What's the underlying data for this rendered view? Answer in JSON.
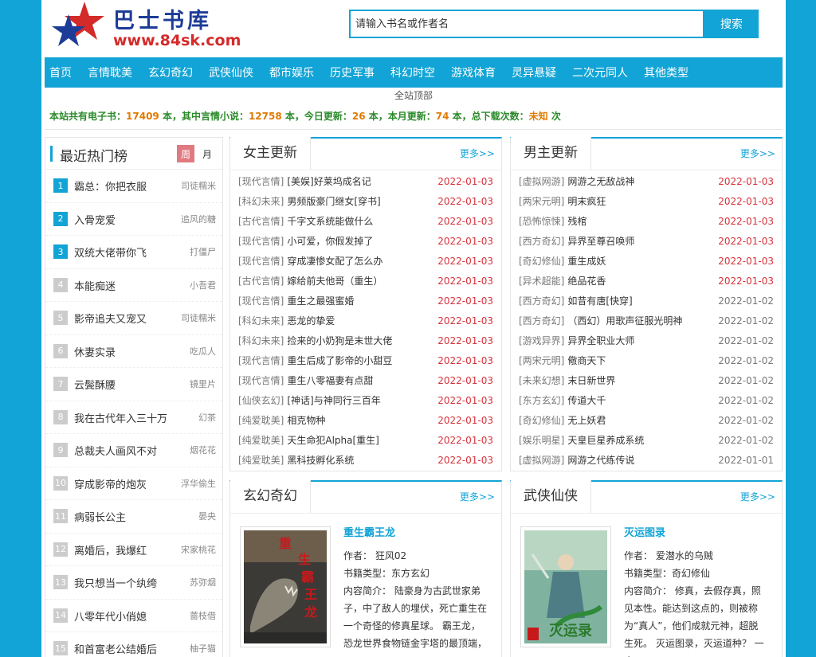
{
  "site": {
    "title": "巴士书库",
    "url": "www.84sk.com"
  },
  "search": {
    "placeholder": "请输入书名或作者名",
    "button": "搜索"
  },
  "nav": [
    "首页",
    "言情耽美",
    "玄幻奇幻",
    "武侠仙侠",
    "都市娱乐",
    "历史军事",
    "科幻时空",
    "游戏体育",
    "灵异悬疑",
    "二次元同人",
    "其他类型"
  ],
  "subnav": "全站顶部",
  "stats": {
    "p1": "本站共有电子书：",
    "total": "17409",
    "p2": " 本，其中言情小说：",
    "romance": "12758",
    "p3": " 本，今日更新：",
    "today": "26",
    "p4": " 本，本月更新：",
    "month": "74",
    "p5": " 本，总下载次数：",
    "downloads": "未知",
    "p6": " 次"
  },
  "rank": {
    "title": "最近热门榜",
    "week": "周",
    "month": "月",
    "items": [
      {
        "n": "1",
        "book": "霸总：你把衣服",
        "author": "司徒糯米"
      },
      {
        "n": "2",
        "book": "入骨宠爱",
        "author": "追风的糖"
      },
      {
        "n": "3",
        "book": "双统大佬带你飞",
        "author": "打僵尸"
      },
      {
        "n": "4",
        "book": "本能痴迷",
        "author": "小吾君"
      },
      {
        "n": "5",
        "book": "影帝追夫又宠又",
        "author": "司徒糯米"
      },
      {
        "n": "6",
        "book": "休妻实录",
        "author": "吃瓜人"
      },
      {
        "n": "7",
        "book": "云鬓酥腰",
        "author": "镜里片"
      },
      {
        "n": "8",
        "book": "我在古代年入三十万",
        "author": "幻茶"
      },
      {
        "n": "9",
        "book": "总裁夫人画风不对",
        "author": "烟花花"
      },
      {
        "n": "10",
        "book": "穿成影帝的炮灰",
        "author": "浮华偷生"
      },
      {
        "n": "11",
        "book": "病弱长公主",
        "author": "晏央"
      },
      {
        "n": "12",
        "book": "离婚后，我爆红",
        "author": "宋家桃花"
      },
      {
        "n": "13",
        "book": "我只想当一个纨绔",
        "author": "苏弥烟"
      },
      {
        "n": "14",
        "book": "八零年代小俏媳",
        "author": "蔷枝借"
      },
      {
        "n": "15",
        "book": "和首富老公结婚后",
        "author": "柚子猫"
      }
    ]
  },
  "female": {
    "title": "女主更新",
    "more": "更多>>",
    "items": [
      {
        "cat": "[现代言情]",
        "name": "[美娱]好莱坞成名记",
        "date": "2022-01-03"
      },
      {
        "cat": "[科幻未来]",
        "name": "男频版豪门继女[穿书]",
        "date": "2022-01-03"
      },
      {
        "cat": "[古代言情]",
        "name": "千字文系统能做什么",
        "date": "2022-01-03"
      },
      {
        "cat": "[现代言情]",
        "name": "小可爱，你假发掉了",
        "date": "2022-01-03"
      },
      {
        "cat": "[现代言情]",
        "name": "穿成凄惨女配了怎么办",
        "date": "2022-01-03"
      },
      {
        "cat": "[古代言情]",
        "name": "嫁给前夫他哥（重生）",
        "date": "2022-01-03"
      },
      {
        "cat": "[现代言情]",
        "name": "重生之最强蜜婚",
        "date": "2022-01-03"
      },
      {
        "cat": "[科幻未来]",
        "name": "恶龙的挚爱",
        "date": "2022-01-03"
      },
      {
        "cat": "[科幻未来]",
        "name": "捡来的小奶狗是末世大佬",
        "date": "2022-01-03"
      },
      {
        "cat": "[现代言情]",
        "name": "重生后成了影帝的小甜豆",
        "date": "2022-01-03"
      },
      {
        "cat": "[现代言情]",
        "name": "重生八零福妻有点甜",
        "date": "2022-01-03"
      },
      {
        "cat": "[仙侠玄幻]",
        "name": "[神话]与神同行三百年",
        "date": "2022-01-03"
      },
      {
        "cat": "[纯爱耽美]",
        "name": "相克物种",
        "date": "2022-01-03"
      },
      {
        "cat": "[纯爱耽美]",
        "name": "天生命犯Alpha[重生]",
        "date": "2022-01-03"
      },
      {
        "cat": "[纯爱耽美]",
        "name": "黑科技孵化系统",
        "date": "2022-01-03"
      }
    ]
  },
  "male": {
    "title": "男主更新",
    "more": "更多>>",
    "items": [
      {
        "cat": "[虚拟网游]",
        "name": "网游之无敌战神",
        "date": "2022-01-03",
        "red": true
      },
      {
        "cat": "[两宋元明]",
        "name": "明末疯狂",
        "date": "2022-01-03",
        "red": true
      },
      {
        "cat": "[恐怖惊悚]",
        "name": "残棺",
        "date": "2022-01-03",
        "red": true
      },
      {
        "cat": "[西方奇幻]",
        "name": "异界至尊召唤师",
        "date": "2022-01-03",
        "red": true
      },
      {
        "cat": "[奇幻修仙]",
        "name": "重生成妖",
        "date": "2022-01-03",
        "red": true
      },
      {
        "cat": "[异术超能]",
        "name": "绝品花香",
        "date": "2022-01-03",
        "red": true
      },
      {
        "cat": "[西方奇幻]",
        "name": "如昔有唐[快穿]",
        "date": "2022-01-02",
        "red": false
      },
      {
        "cat": "[西方奇幻]",
        "name": "（西幻）用歌声征服光明神",
        "date": "2022-01-02",
        "red": false
      },
      {
        "cat": "[游戏异界]",
        "name": "异界全职业大师",
        "date": "2022-01-02",
        "red": false
      },
      {
        "cat": "[两宋元明]",
        "name": "儆商天下",
        "date": "2022-01-02",
        "red": false
      },
      {
        "cat": "[未来幻想]",
        "name": "末日新世界",
        "date": "2022-01-02",
        "red": false
      },
      {
        "cat": "[东方玄幻]",
        "name": "传道大千",
        "date": "2022-01-02",
        "red": false
      },
      {
        "cat": "[奇幻修仙]",
        "name": "无上妖君",
        "date": "2022-01-02",
        "red": false
      },
      {
        "cat": "[娱乐明星]",
        "name": "天皇巨星养成系统",
        "date": "2022-01-02",
        "red": false
      },
      {
        "cat": "[虚拟网游]",
        "name": "网游之代练传说",
        "date": "2022-01-01",
        "red": false
      }
    ]
  },
  "xuanhuan": {
    "title": "玄幻奇幻",
    "more": "更多>>",
    "book": "重生霸王龙",
    "author": "作者： 狂风02",
    "type": "书籍类型：东方玄幻",
    "intro": "内容简介： 陆豪身为古武世家弟子，中了敌人的埋伏，死亡重生在一个奇怪的修真星球。 霸王龙，恐龙世界食物链金字塔的最顶端，"
  },
  "wuxia": {
    "title": "武侠仙侠",
    "more": "更多>>",
    "book": "灭运图录",
    "author": "作者： 爱潜水的乌贼",
    "type": "书籍类型：奇幻修仙",
    "intro": "内容简介： 修真，去假存真，照见本性。能达到这点的，则被称为“真人”，他们成就元神，超脱生死。 灭运图录，灭运道种？ 一个"
  },
  "colors": {
    "accent": "#12a4d6",
    "date_red": "#d6323a",
    "stats_green": "#2a8a2a",
    "stats_orange": "#e07a00"
  },
  "icons": {
    "logo": "star-logo-icon"
  }
}
